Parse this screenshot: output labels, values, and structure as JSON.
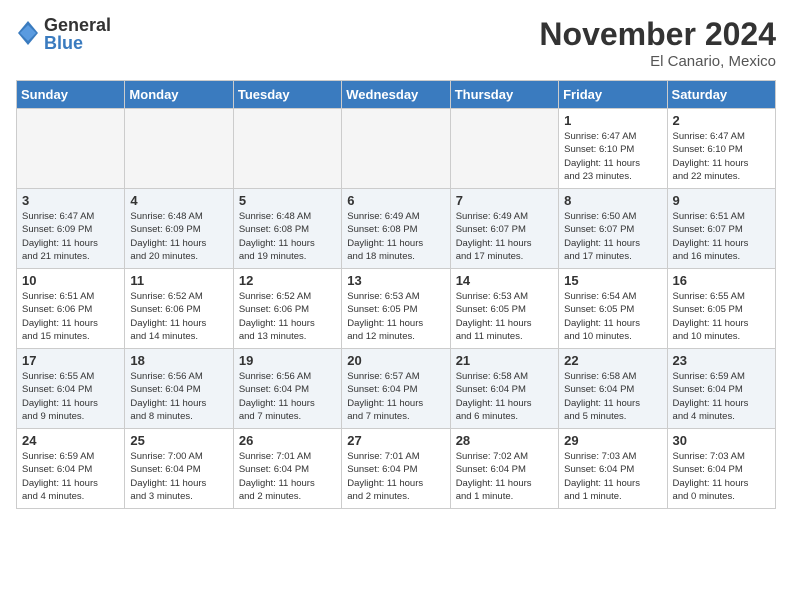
{
  "header": {
    "logo_general": "General",
    "logo_blue": "Blue",
    "month_title": "November 2024",
    "location": "El Canario, Mexico"
  },
  "days_of_week": [
    "Sunday",
    "Monday",
    "Tuesday",
    "Wednesday",
    "Thursday",
    "Friday",
    "Saturday"
  ],
  "weeks": [
    {
      "alt": false,
      "days": [
        {
          "num": "",
          "info": "",
          "empty": true
        },
        {
          "num": "",
          "info": "",
          "empty": true
        },
        {
          "num": "",
          "info": "",
          "empty": true
        },
        {
          "num": "",
          "info": "",
          "empty": true
        },
        {
          "num": "",
          "info": "",
          "empty": true
        },
        {
          "num": "1",
          "info": "Sunrise: 6:47 AM\nSunset: 6:10 PM\nDaylight: 11 hours\nand 23 minutes.",
          "empty": false
        },
        {
          "num": "2",
          "info": "Sunrise: 6:47 AM\nSunset: 6:10 PM\nDaylight: 11 hours\nand 22 minutes.",
          "empty": false
        }
      ]
    },
    {
      "alt": true,
      "days": [
        {
          "num": "3",
          "info": "Sunrise: 6:47 AM\nSunset: 6:09 PM\nDaylight: 11 hours\nand 21 minutes.",
          "empty": false
        },
        {
          "num": "4",
          "info": "Sunrise: 6:48 AM\nSunset: 6:09 PM\nDaylight: 11 hours\nand 20 minutes.",
          "empty": false
        },
        {
          "num": "5",
          "info": "Sunrise: 6:48 AM\nSunset: 6:08 PM\nDaylight: 11 hours\nand 19 minutes.",
          "empty": false
        },
        {
          "num": "6",
          "info": "Sunrise: 6:49 AM\nSunset: 6:08 PM\nDaylight: 11 hours\nand 18 minutes.",
          "empty": false
        },
        {
          "num": "7",
          "info": "Sunrise: 6:49 AM\nSunset: 6:07 PM\nDaylight: 11 hours\nand 17 minutes.",
          "empty": false
        },
        {
          "num": "8",
          "info": "Sunrise: 6:50 AM\nSunset: 6:07 PM\nDaylight: 11 hours\nand 17 minutes.",
          "empty": false
        },
        {
          "num": "9",
          "info": "Sunrise: 6:51 AM\nSunset: 6:07 PM\nDaylight: 11 hours\nand 16 minutes.",
          "empty": false
        }
      ]
    },
    {
      "alt": false,
      "days": [
        {
          "num": "10",
          "info": "Sunrise: 6:51 AM\nSunset: 6:06 PM\nDaylight: 11 hours\nand 15 minutes.",
          "empty": false
        },
        {
          "num": "11",
          "info": "Sunrise: 6:52 AM\nSunset: 6:06 PM\nDaylight: 11 hours\nand 14 minutes.",
          "empty": false
        },
        {
          "num": "12",
          "info": "Sunrise: 6:52 AM\nSunset: 6:06 PM\nDaylight: 11 hours\nand 13 minutes.",
          "empty": false
        },
        {
          "num": "13",
          "info": "Sunrise: 6:53 AM\nSunset: 6:05 PM\nDaylight: 11 hours\nand 12 minutes.",
          "empty": false
        },
        {
          "num": "14",
          "info": "Sunrise: 6:53 AM\nSunset: 6:05 PM\nDaylight: 11 hours\nand 11 minutes.",
          "empty": false
        },
        {
          "num": "15",
          "info": "Sunrise: 6:54 AM\nSunset: 6:05 PM\nDaylight: 11 hours\nand 10 minutes.",
          "empty": false
        },
        {
          "num": "16",
          "info": "Sunrise: 6:55 AM\nSunset: 6:05 PM\nDaylight: 11 hours\nand 10 minutes.",
          "empty": false
        }
      ]
    },
    {
      "alt": true,
      "days": [
        {
          "num": "17",
          "info": "Sunrise: 6:55 AM\nSunset: 6:04 PM\nDaylight: 11 hours\nand 9 minutes.",
          "empty": false
        },
        {
          "num": "18",
          "info": "Sunrise: 6:56 AM\nSunset: 6:04 PM\nDaylight: 11 hours\nand 8 minutes.",
          "empty": false
        },
        {
          "num": "19",
          "info": "Sunrise: 6:56 AM\nSunset: 6:04 PM\nDaylight: 11 hours\nand 7 minutes.",
          "empty": false
        },
        {
          "num": "20",
          "info": "Sunrise: 6:57 AM\nSunset: 6:04 PM\nDaylight: 11 hours\nand 7 minutes.",
          "empty": false
        },
        {
          "num": "21",
          "info": "Sunrise: 6:58 AM\nSunset: 6:04 PM\nDaylight: 11 hours\nand 6 minutes.",
          "empty": false
        },
        {
          "num": "22",
          "info": "Sunrise: 6:58 AM\nSunset: 6:04 PM\nDaylight: 11 hours\nand 5 minutes.",
          "empty": false
        },
        {
          "num": "23",
          "info": "Sunrise: 6:59 AM\nSunset: 6:04 PM\nDaylight: 11 hours\nand 4 minutes.",
          "empty": false
        }
      ]
    },
    {
      "alt": false,
      "days": [
        {
          "num": "24",
          "info": "Sunrise: 6:59 AM\nSunset: 6:04 PM\nDaylight: 11 hours\nand 4 minutes.",
          "empty": false
        },
        {
          "num": "25",
          "info": "Sunrise: 7:00 AM\nSunset: 6:04 PM\nDaylight: 11 hours\nand 3 minutes.",
          "empty": false
        },
        {
          "num": "26",
          "info": "Sunrise: 7:01 AM\nSunset: 6:04 PM\nDaylight: 11 hours\nand 2 minutes.",
          "empty": false
        },
        {
          "num": "27",
          "info": "Sunrise: 7:01 AM\nSunset: 6:04 PM\nDaylight: 11 hours\nand 2 minutes.",
          "empty": false
        },
        {
          "num": "28",
          "info": "Sunrise: 7:02 AM\nSunset: 6:04 PM\nDaylight: 11 hours\nand 1 minute.",
          "empty": false
        },
        {
          "num": "29",
          "info": "Sunrise: 7:03 AM\nSunset: 6:04 PM\nDaylight: 11 hours\nand 1 minute.",
          "empty": false
        },
        {
          "num": "30",
          "info": "Sunrise: 7:03 AM\nSunset: 6:04 PM\nDaylight: 11 hours\nand 0 minutes.",
          "empty": false
        }
      ]
    }
  ]
}
